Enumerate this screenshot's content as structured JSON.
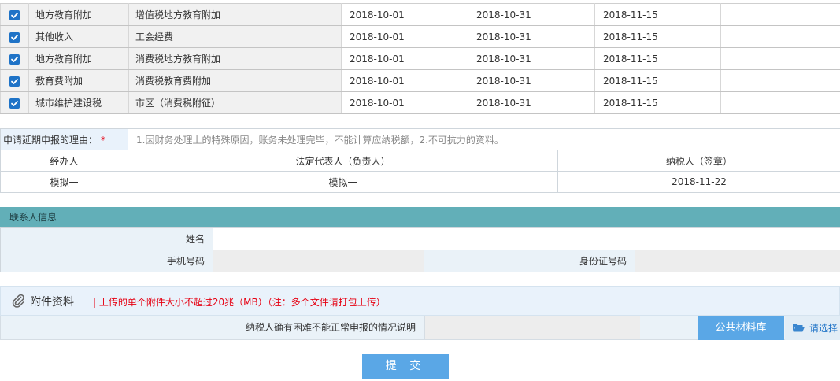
{
  "tax_rows": [
    {
      "checked": true,
      "tax_type": "地方教育附加",
      "item": "增值税地方教育附加",
      "period_start": "2018-10-01",
      "period_end": "2018-10-31",
      "deadline": "2018-11-15"
    },
    {
      "checked": true,
      "tax_type": "其他收入",
      "item": "工会经费",
      "period_start": "2018-10-01",
      "period_end": "2018-10-31",
      "deadline": "2018-11-15"
    },
    {
      "checked": true,
      "tax_type": "地方教育附加",
      "item": "消费税地方教育附加",
      "period_start": "2018-10-01",
      "period_end": "2018-10-31",
      "deadline": "2018-11-15"
    },
    {
      "checked": true,
      "tax_type": "教育费附加",
      "item": "消费税教育费附加",
      "period_start": "2018-10-01",
      "period_end": "2018-10-31",
      "deadline": "2018-11-15"
    },
    {
      "checked": true,
      "tax_type": "城市维护建设税",
      "item": "市区（消费税附征）",
      "period_start": "2018-10-01",
      "period_end": "2018-10-31",
      "deadline": "2018-11-15"
    }
  ],
  "reason": {
    "label": "申请延期申报的理由：",
    "required_mark": "*",
    "text": "1.因财务处理上的特殊原因，账务未处理完毕，不能计算应纳税额，2.不可抗力的资料。"
  },
  "signers": {
    "headers": [
      "经办人",
      "法定代表人（负责人）",
      "纳税人（签章）"
    ],
    "values": [
      "模拟一",
      "模拟一",
      "2018-11-22"
    ]
  },
  "contact": {
    "title": "联系人信息",
    "name_label": "姓名",
    "phone_label": "手机号码",
    "id_label": "身份证号码"
  },
  "attachments": {
    "title": "附件资料",
    "note": "| 上传的单个附件大小不超过20兆（MB）（注：多个文件请打包上传）",
    "row_label": "纳税人确有困难不能正常申报的情况说明",
    "library_button": "公共材料库",
    "choose_button": "请选择"
  },
  "submit_label": "提 交",
  "colors": {
    "checkbox": "#1f73c7",
    "section_header": "#62afb8",
    "primary_button": "#5aa7e6",
    "required": "#e60012"
  }
}
